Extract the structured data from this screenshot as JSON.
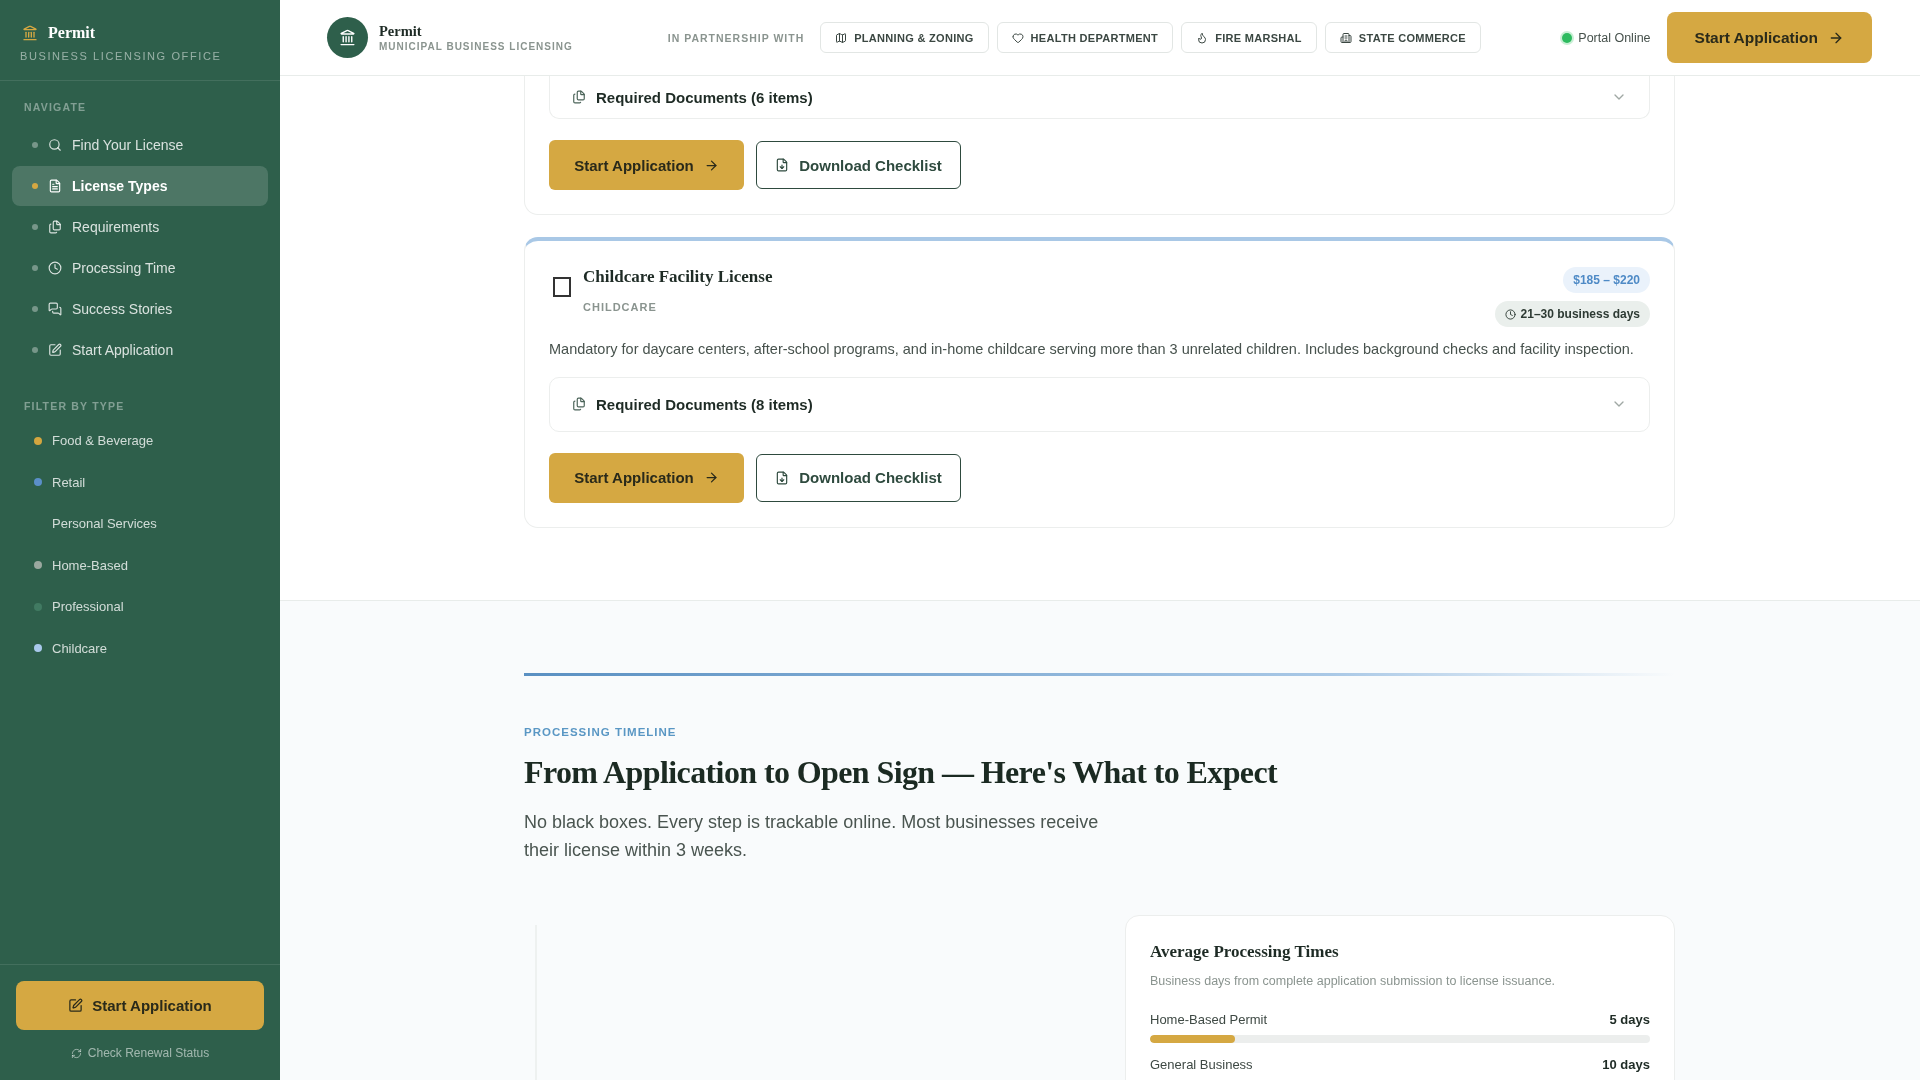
{
  "sidebar": {
    "brand": "Permit",
    "subtitle": "BUSINESS LICENSING OFFICE",
    "nav_heading": "NAVIGATE",
    "nav_items": [
      {
        "label": "Find Your License",
        "selected": false
      },
      {
        "label": "License Types",
        "selected": true
      },
      {
        "label": "Requirements",
        "selected": false
      },
      {
        "label": "Processing Time",
        "selected": false
      },
      {
        "label": "Success Stories",
        "selected": false
      },
      {
        "label": "Start Application",
        "selected": false
      }
    ],
    "filter_heading": "FILTER BY TYPE",
    "filters": [
      {
        "label": "Food & Beverage",
        "color": "#d4a63f"
      },
      {
        "label": "Retail",
        "color": "#5b8fc9"
      },
      {
        "label": "Personal Services"
      },
      {
        "label": "Home-Based",
        "color": "#9aa89f"
      },
      {
        "label": "Professional",
        "color": "#417a62"
      },
      {
        "label": "Childcare",
        "color": "#a9c9ec"
      }
    ],
    "cta": "Start Application",
    "renewal_link": "Check Renewal Status"
  },
  "header": {
    "brand": "Permit",
    "subtitle": "MUNICIPAL BUSINESS LICENSING",
    "partner_label": "IN PARTNERSHIP WITH",
    "partners": [
      {
        "label": "PLANNING & ZONING"
      },
      {
        "label": "HEALTH DEPARTMENT"
      },
      {
        "label": "FIRE MARSHAL"
      },
      {
        "label": "STATE COMMERCE"
      }
    ],
    "status": "Portal Online",
    "cta": "Start Application"
  },
  "license_cards": [
    {
      "documents": "Required Documents (6 items)",
      "expanded": false,
      "primary": "Start Application",
      "secondary": "Download Checklist"
    },
    {
      "title": "Childcare Facility License",
      "checked": false,
      "category": "CHILDCARE",
      "price": "$185 – $220",
      "duration": "21–30 business days",
      "description": "Mandatory for daycare centers, after-school programs, and in-home childcare serving more than 3 unrelated children. Includes background checks and facility inspection.",
      "documents": "Required Documents (8 items)",
      "expanded": false,
      "primary": "Start Application",
      "secondary": "Download Checklist"
    }
  ],
  "timeline": {
    "eyebrow": "PROCESSING TIMELINE",
    "title": "From Application to Open Sign — Here's What to Expect",
    "lead": "No black boxes. Every step is trackable online. Most businesses receive their license within 3 weeks.",
    "averages": {
      "title": "Average Processing Times",
      "subtitle": "Business days from complete application submission to license issuance.",
      "rows": [
        {
          "label": "Home-Based Permit",
          "value": "5 days",
          "level": 0.17
        },
        {
          "label": "General Business",
          "value": "10 days"
        }
      ]
    }
  }
}
